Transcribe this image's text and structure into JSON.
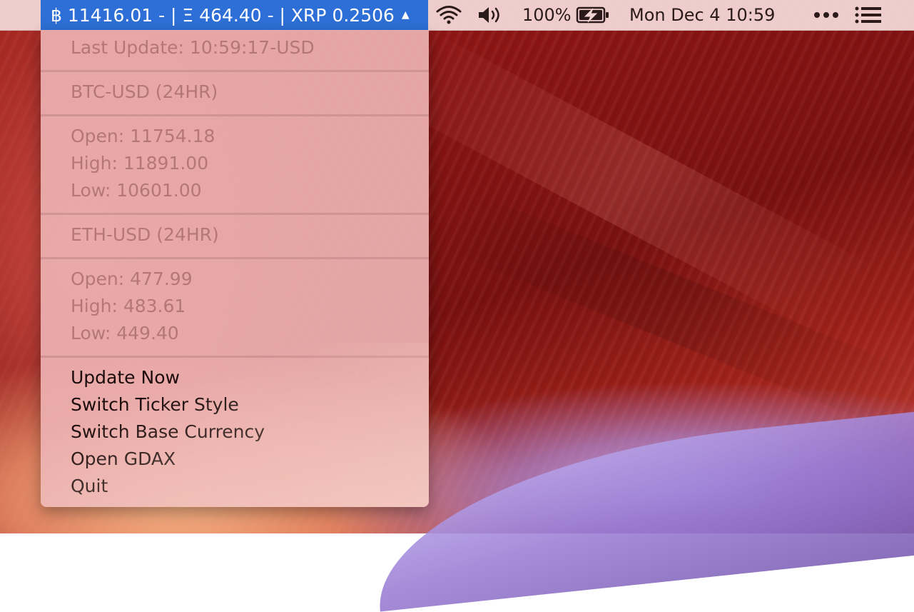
{
  "menubar": {
    "ticker": "฿ 11416.01 - | Ξ 464.40 - | XRP 0.2506",
    "ticker_arrow": "▲",
    "battery": "100%",
    "clock": "Mon Dec 4  10:59"
  },
  "menu": {
    "last_update": "Last Update: 10:59:17-USD",
    "btc_header": "BTC-USD (24HR)",
    "btc_open": "Open: 11754.18",
    "btc_high": "High: 11891.00",
    "btc_low": "Low: 10601.00",
    "eth_header": "ETH-USD (24HR)",
    "eth_open": "Open: 477.99",
    "eth_high": "High: 483.61",
    "eth_low": "Low: 449.40",
    "actions": {
      "update_now": "Update Now",
      "switch_ticker_style": "Switch Ticker Style",
      "switch_base_currency": "Switch Base Currency",
      "open_gdax": "Open GDAX",
      "quit": "Quit"
    }
  },
  "icons": [
    "wifi-icon",
    "volume-icon",
    "battery-charging-icon",
    "more-icon",
    "notification-center-icon"
  ],
  "colors": {
    "ticker_bg": "#2d6fd6",
    "menubar_bg": "#f2d4d4",
    "menu_bg": "#ecb0b0"
  }
}
